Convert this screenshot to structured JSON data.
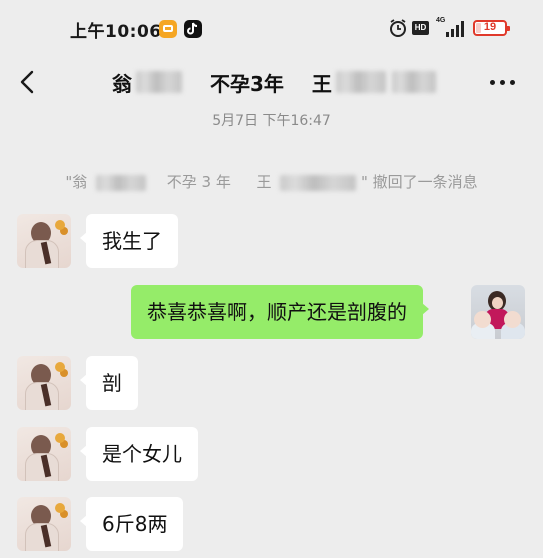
{
  "status_bar": {
    "time": "上午10:06",
    "app_icons": [
      "notes-app-icon",
      "tiktok-icon"
    ],
    "network": "4G",
    "hd_label": "HD",
    "battery_level": "19",
    "battery_fraction": 0.19,
    "battery_color": "#e0392b"
  },
  "header": {
    "title_part1": "翁",
    "title_part2": "不孕3年",
    "title_part3": "王",
    "back_icon": "chevron-left-icon",
    "more_icon": "more-dots-icon"
  },
  "timestamp": "5月7日 下午16:47",
  "recall_notice": {
    "prefix": "\"翁",
    "middle": "不孕 3 年",
    "name_start": "王",
    "suffix": "\" 撤回了一条消息"
  },
  "messages": [
    {
      "side": "left",
      "text": "我生了"
    },
    {
      "side": "right",
      "text": "恭喜恭喜啊，顺产还是剖腹的"
    },
    {
      "side": "left",
      "text": "剖"
    },
    {
      "side": "left",
      "text": "是个女儿"
    },
    {
      "side": "left",
      "text": "6斤8两"
    }
  ],
  "colors": {
    "background": "#ededed",
    "incoming_bubble": "#ffffff",
    "outgoing_bubble": "#95ec69"
  }
}
